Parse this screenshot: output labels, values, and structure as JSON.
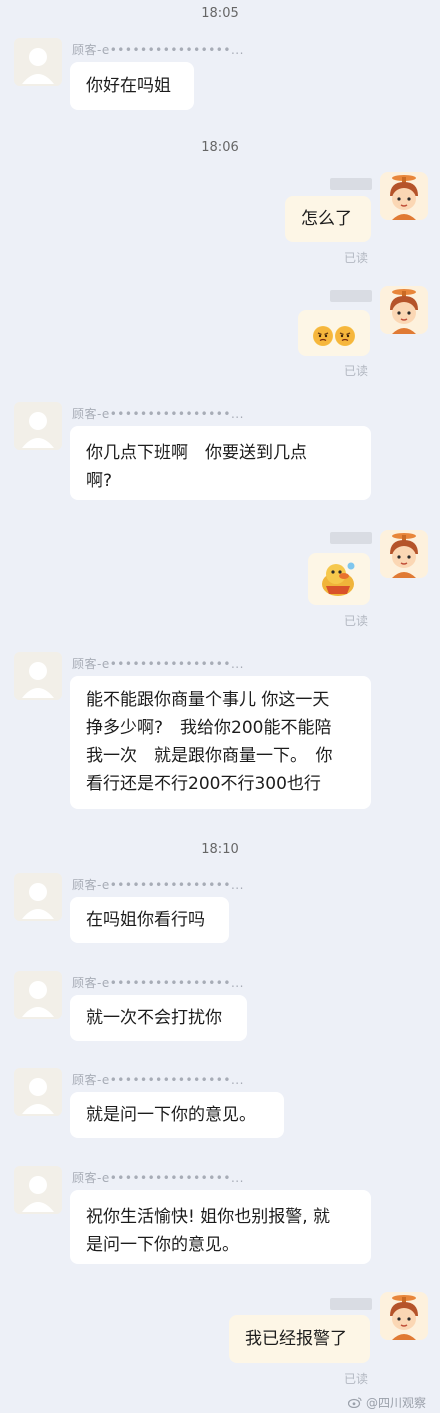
{
  "colors": {
    "background": "#edf0f7",
    "bubble_other": "#ffffff",
    "bubble_me": "#fdf6e6",
    "read_status": "#b3b8c2"
  },
  "timestamps": [
    "18:05",
    "18:06",
    "18:10"
  ],
  "customer_name": "顾客-e••••••••••••••••...",
  "messages": [
    {
      "sender": "customer",
      "text": "你好在吗姐"
    },
    {
      "sender": "me",
      "text": "怎么了",
      "status": "已读"
    },
    {
      "sender": "me",
      "emoji": "angry-face-pair",
      "status": "已读"
    },
    {
      "sender": "customer",
      "lines": [
        "你几点下班啊　你要送到几点",
        "啊?"
      ]
    },
    {
      "sender": "me",
      "emoji": "duck-sticker",
      "status": "已读"
    },
    {
      "sender": "customer",
      "lines": [
        "能不能跟你商量个事儿 你这一天",
        "挣多少啊?　我给你200能不能陪",
        "我一次　就是跟你商量一下。　你",
        "看行还是不行200不行300也行"
      ]
    },
    {
      "sender": "customer",
      "text": "在吗姐你看行吗"
    },
    {
      "sender": "customer",
      "text": "就一次不会打扰你"
    },
    {
      "sender": "customer",
      "text": "就是问一下你的意见。"
    },
    {
      "sender": "customer",
      "lines": [
        "祝你生活愉快! 姐你也别报警, 就",
        "是问一下你的意见。"
      ]
    },
    {
      "sender": "me",
      "text": "我已经报警了",
      "status": "已读"
    }
  ],
  "watermark": "@四川观察",
  "icons": {
    "customer_avatar": "default-user-avatar-icon",
    "me_avatar": "cartoon-boy-propeller-hat-avatar-icon"
  }
}
